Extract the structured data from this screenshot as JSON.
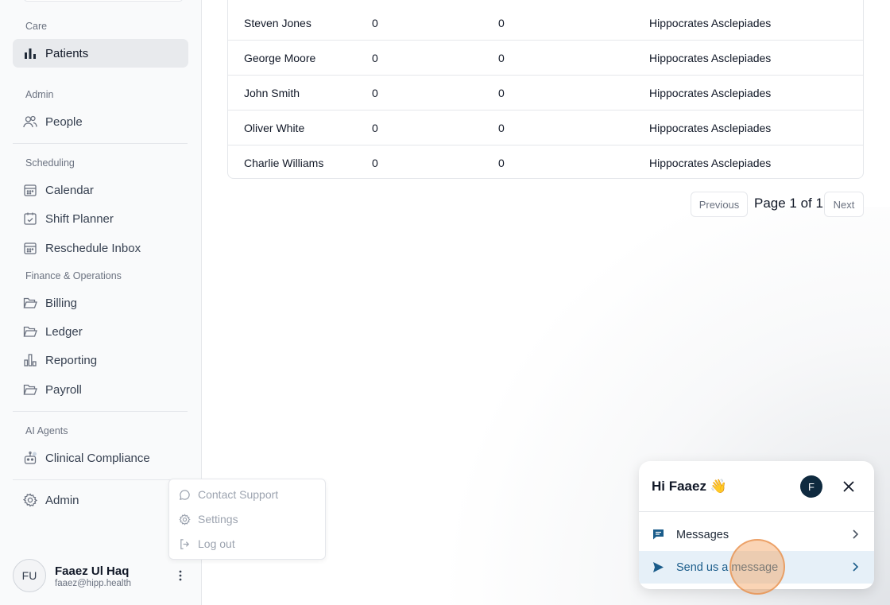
{
  "sidebar": {
    "sections": {
      "care": "Care",
      "admin": "Admin",
      "scheduling": "Scheduling",
      "finance": "Finance & Operations",
      "ai_agents": "AI Agents"
    },
    "items": {
      "patients": "Patients",
      "people": "People",
      "calendar": "Calendar",
      "shift_planner": "Shift Planner",
      "reschedule_inbox": "Reschedule Inbox",
      "billing": "Billing",
      "ledger": "Ledger",
      "reporting": "Reporting",
      "payroll": "Payroll",
      "clinical_compliance": "Clinical Compliance",
      "admin": "Admin"
    },
    "active_item": "Patients",
    "user": {
      "initials": "FU",
      "name": "Faaez Ul Haq",
      "email": "faaez@hipp.health"
    }
  },
  "popup_menu": {
    "items": [
      "Contact Support",
      "Settings",
      "Log out"
    ]
  },
  "table": {
    "rows": [
      [
        "Steven Jones",
        "0",
        "0",
        "Hippocrates Asclepiades"
      ],
      [
        "George Moore",
        "0",
        "0",
        "Hippocrates Asclepiades"
      ],
      [
        "John Smith",
        "0",
        "0",
        "Hippocrates Asclepiades"
      ],
      [
        "Oliver White",
        "0",
        "0",
        "Hippocrates Asclepiades"
      ],
      [
        "Charlie Williams",
        "0",
        "0",
        "Hippocrates Asclepiades"
      ]
    ]
  },
  "pagination": {
    "previous": "Previous",
    "page_text": "Page 1 of 1",
    "next": "Next"
  },
  "chat": {
    "greeting": "Hi Faaez 👋",
    "avatar_initial": "F",
    "messages_label": "Messages",
    "send_label": "Send us a message",
    "accent_color": "#1a5c8a"
  }
}
